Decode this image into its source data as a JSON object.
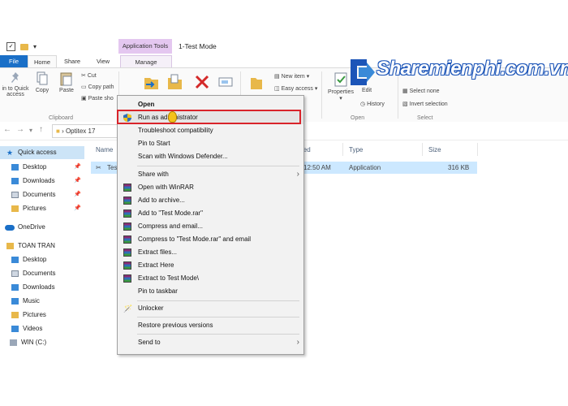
{
  "window": {
    "title": "1-Test Mode",
    "application_tools": "Application Tools"
  },
  "tabs": [
    "File",
    "Home",
    "Share",
    "View",
    "Manage"
  ],
  "ribbon": {
    "clipboard": {
      "pin_label_1": "in to Quick",
      "pin_label_2": "access",
      "copy": "Copy",
      "paste": "Paste",
      "cut": "Cut",
      "copy_path": "Copy path",
      "paste_shortcut": "Paste sho",
      "group": "Clipboard"
    },
    "new": {
      "new_item": "New item",
      "easy_access": "Easy access"
    },
    "open": {
      "properties": "Properties",
      "edit": "Edit",
      "history": "History",
      "group": "Open"
    },
    "select": {
      "select_none": "Select none",
      "invert_selection": "Invert selection",
      "group": "Select"
    }
  },
  "address": {
    "path": "Optitex 17"
  },
  "nav": {
    "quick_access": "Quick access",
    "items": [
      "Desktop",
      "Downloads",
      "Documents",
      "Pictures"
    ],
    "onedrive": "OneDrive",
    "user": "TOAN TRAN",
    "user_items": [
      "Desktop",
      "Documents",
      "Downloads",
      "Music",
      "Pictures",
      "Videos",
      "WIN (C:)"
    ]
  },
  "columns": {
    "name": "Name",
    "date": "ied",
    "type": "Type",
    "size": "Size"
  },
  "file_row": {
    "name": "Tes",
    "date": "12:50 AM",
    "type": "Application",
    "size": "316 KB"
  },
  "context_menu": {
    "open": "Open",
    "run_as_admin": "Run as administrator",
    "troubleshoot": "Troubleshoot compatibility",
    "pin_start": "Pin to Start",
    "scan_defender": "Scan with Windows Defender...",
    "share_with": "Share with",
    "open_winrar": "Open with WinRAR",
    "add_archive": "Add to archive...",
    "add_rar": "Add to \"Test Mode.rar\"",
    "compress_email": "Compress and email...",
    "compress_rar_email": "Compress to \"Test Mode.rar\" and email",
    "extract_files": "Extract files...",
    "extract_here": "Extract Here",
    "extract_to": "Extract to Test Mode\\",
    "pin_taskbar": "Pin to taskbar",
    "unlocker": "Unlocker",
    "restore_versions": "Restore previous versions",
    "send_to": "Send to"
  },
  "watermark": {
    "text": "Sharemienphi.com.vn"
  },
  "colors": {
    "file_tab": "#1a6fc7",
    "application_tools": "#e4c7f0",
    "selection": "#cce8ff",
    "highlight_box": "#d9242b",
    "watermark": "#1c55b8"
  }
}
